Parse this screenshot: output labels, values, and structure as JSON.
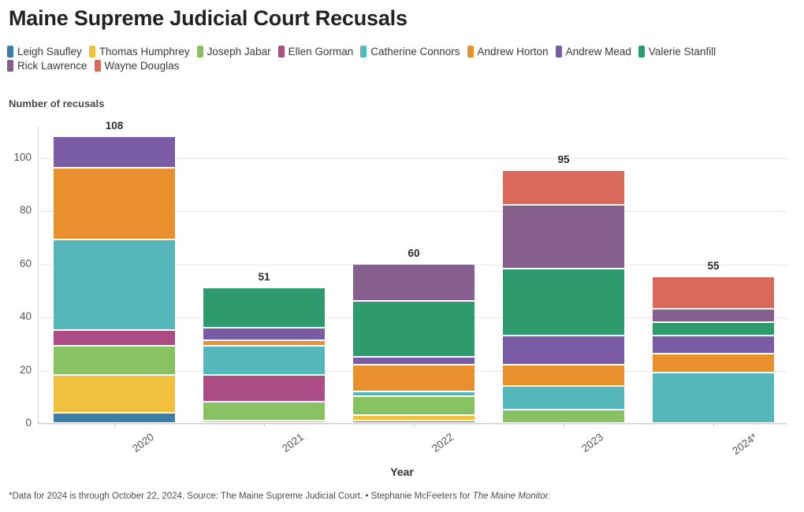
{
  "title": "Maine Supreme Judicial Court Recusals",
  "axis": {
    "y_title": "Number of recusals",
    "x_title": "Year"
  },
  "footnote": {
    "text": "*Data for 2024 is through October 22, 2024. Source: The Maine Supreme Judicial Court. • Stephanie McFeeters for ",
    "italic": "The Maine Monitor."
  },
  "chart_data": {
    "type": "bar",
    "subtype": "stacked-bar",
    "title": "Maine Supreme Judicial Court Recusals",
    "xlabel": "Year",
    "ylabel": "Number of recusals",
    "categories": [
      "2020",
      "2021",
      "2022",
      "2023",
      "2024*"
    ],
    "ylim": [
      0,
      112
    ],
    "yticks": [
      0,
      20,
      40,
      60,
      80,
      100
    ],
    "ytick_labels": [
      "0",
      "20",
      "40",
      "60",
      "80",
      "100"
    ],
    "grid": true,
    "legend_position": "top",
    "totals": [
      108,
      51,
      60,
      95,
      55
    ],
    "series": [
      {
        "name": "Leigh Saufley",
        "color": "#3b7ea6",
        "values": [
          4,
          0,
          1,
          0,
          0
        ]
      },
      {
        "name": "Thomas Humphrey",
        "color": "#f0c03c",
        "values": [
          14,
          1,
          2,
          0,
          0
        ]
      },
      {
        "name": "Joseph Jabar",
        "color": "#88c162",
        "values": [
          11,
          7,
          7,
          5,
          0
        ]
      },
      {
        "name": "Ellen Gorman",
        "color": "#ab4c84",
        "values": [
          6,
          10,
          0,
          0,
          0
        ]
      },
      {
        "name": "Catherine Connors",
        "color": "#56b7ba",
        "values": [
          34,
          11,
          2,
          9,
          19
        ]
      },
      {
        "name": "Andrew Horton",
        "color": "#e8902e",
        "values": [
          27,
          2,
          10,
          8,
          7
        ]
      },
      {
        "name": "Andrew Mead",
        "color": "#7a5ca5",
        "values": [
          12,
          5,
          3,
          11,
          7
        ]
      },
      {
        "name": "Valerie Stanfill",
        "color": "#2e9b6f",
        "values": [
          0,
          15,
          21,
          25,
          5
        ]
      },
      {
        "name": "Rick Lawrence",
        "color": "#85608e",
        "values": [
          0,
          0,
          14,
          24,
          5
        ]
      },
      {
        "name": "Wayne Douglas",
        "color": "#d9695a",
        "values": [
          0,
          0,
          0,
          13,
          12
        ]
      }
    ]
  }
}
